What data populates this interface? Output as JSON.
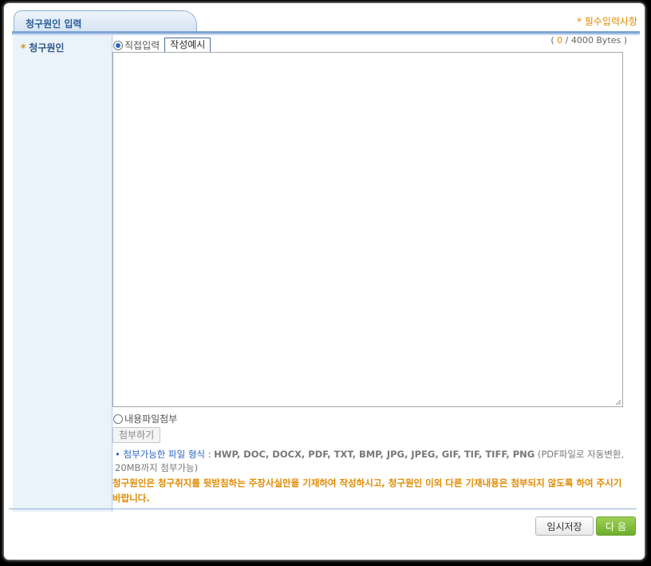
{
  "header": {
    "tab_title": "청구원인 입력",
    "required_note": "* 필수입력사항"
  },
  "field": {
    "star": "*",
    "label": "청구원인"
  },
  "input_mode": {
    "direct_label": "직접입력",
    "direct_selected": true,
    "sample_button": "작성예시",
    "byte_open": "(",
    "byte_count": "0",
    "byte_sep": "/",
    "byte_max": "4000 Bytes",
    "byte_close": ")",
    "file_label": "내용파일첨부",
    "file_selected": false,
    "attach_button": "첨부하기"
  },
  "formats": {
    "bullet": "•",
    "label": "첨부가능한 파일 형식 :",
    "list": "HWP, DOC, DOCX, PDF, TXT, BMP, JPG, JPEG, GIF, TIF, TIFF, PNG",
    "note": "(PDF파일로 자동변환, 20MB까지 첨부가능)"
  },
  "warning": "청구원인은 청구취지를 뒷받침하는 주장사실만을 기재하여 작성하시고, 청구원인 이외 다른 기재내용은 첨부되지 않도록 하여 주시기 바랍니다.",
  "footer": {
    "save_temp": "임시저장",
    "next": "다 음"
  },
  "colors": {
    "accent_blue": "#2a5c97",
    "required_orange": "#e08b00",
    "next_green": "#6eae2c"
  }
}
